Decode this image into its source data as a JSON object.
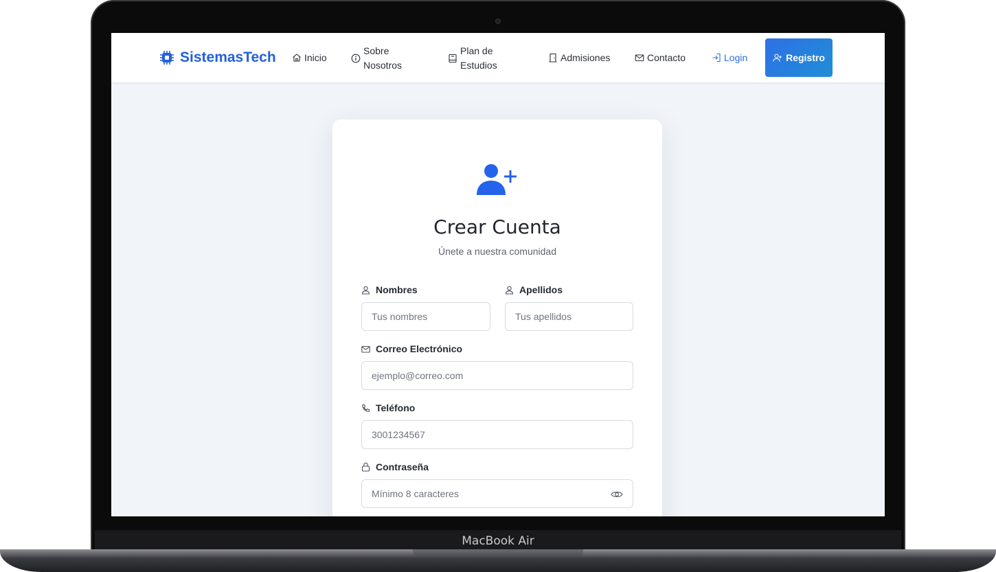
{
  "brand": {
    "name": "SistemasTech",
    "color": "#2260db"
  },
  "nav": {
    "inicio": "Inicio",
    "sobre_line1": "Sobre",
    "sobre_line2": "Nosotros",
    "plan_line1": "Plan de",
    "plan_line2": "Estudios",
    "admisiones": "Admisiones",
    "contacto": "Contacto",
    "login": "Login",
    "registro": "Registro"
  },
  "form": {
    "title": "Crear Cuenta",
    "subtitle": "Únete a nuestra comunidad",
    "nombres_label": "Nombres",
    "nombres_placeholder": "Tus nombres",
    "apellidos_label": "Apellidos",
    "apellidos_placeholder": "Tus apellidos",
    "correo_label": "Correo Electrónico",
    "correo_placeholder": "ejemplo@correo.com",
    "telefono_label": "Teléfono",
    "telefono_placeholder": "3001234567",
    "contrasena_label": "Contraseña",
    "contrasena_placeholder": "Mínimo 8 caracteres"
  },
  "device": {
    "label": "MacBook Air"
  },
  "colors": {
    "accent": "#2b6de0",
    "background": "#f1f4f8"
  }
}
